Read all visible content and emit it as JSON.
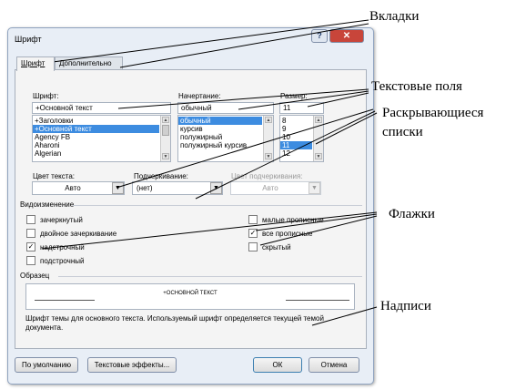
{
  "window": {
    "title": "Шрифт",
    "help_label": "?",
    "close_label": "✕"
  },
  "tabs": [
    "Шрифт",
    "Дополнительно"
  ],
  "font": {
    "label": "Шрифт:",
    "value": "+Основной текст",
    "items": [
      "+Заголовки",
      "+Основной текст",
      "Agency FB",
      "Aharoni",
      "Algerian"
    ],
    "selected_index": 1
  },
  "style": {
    "label": "Начертание:",
    "value": "обычный",
    "items": [
      "обычный",
      "курсив",
      "полужирный",
      "полужирный курсив"
    ],
    "selected_index": 0
  },
  "size": {
    "label": "Размер:",
    "value": "11",
    "items": [
      "8",
      "9",
      "10",
      "11",
      "12"
    ],
    "selected_index": 3
  },
  "color": {
    "label": "Цвет текста:",
    "value": "Авто"
  },
  "underline": {
    "label": "Подчеркивание:",
    "value": "(нет)"
  },
  "underline_color": {
    "label": "Цвет подчеркивания:",
    "value": "Авто"
  },
  "effects": {
    "label": "Видоизменение",
    "left": [
      {
        "label": "зачеркнутый",
        "checked": false
      },
      {
        "label": "двойное зачеркивание",
        "checked": false
      },
      {
        "label": "надстрочный",
        "checked": true
      },
      {
        "label": "подстрочный",
        "checked": false
      }
    ],
    "right": [
      {
        "label": "малые прописные",
        "checked": false
      },
      {
        "label": "все прописные",
        "checked": true
      },
      {
        "label": "скрытый",
        "checked": false
      }
    ]
  },
  "preview": {
    "label": "Образец",
    "text": "+ОСНОВНОЙ ТЕКСТ",
    "note": "Шрифт темы для основного текста. Используемый шрифт определяется текущей темой документа."
  },
  "buttons": {
    "default": "По умолчанию",
    "text_effects": "Текстовые эффекты...",
    "ok": "ОК",
    "cancel": "Отмена"
  },
  "annotations": {
    "tabs": "Вкладки",
    "text_fields": "Текстовые поля",
    "dropdowns_1": "Раскрывающиеся",
    "dropdowns_2": "списки",
    "checkboxes": "Флажки",
    "labels": "Надписи"
  },
  "colors": {
    "selection": "#3d8ce0",
    "window_bg": "#e8eef6",
    "close_button": "#c8453a"
  }
}
